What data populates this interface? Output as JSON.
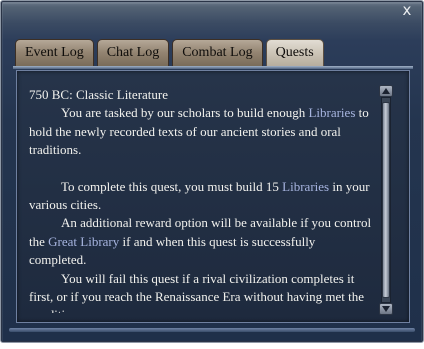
{
  "window": {
    "close_label": "x"
  },
  "tabs": [
    {
      "label": "Event Log",
      "active": false
    },
    {
      "label": "Chat Log",
      "active": false
    },
    {
      "label": "Combat Log",
      "active": false
    },
    {
      "label": "Quests",
      "active": true
    }
  ],
  "quest": {
    "heading": "750 BC: Classic Literature",
    "p1": {
      "before": "You are tasked by our scholars to build enough ",
      "link": "Libraries",
      "after": " to hold the newly recorded texts of our ancient stories and oral traditions."
    },
    "p2": {
      "before": "To complete this quest, you must build 15 ",
      "link": "Libraries",
      "after": " in your various cities."
    },
    "p3": {
      "before": "An additional reward option will be available if you control the ",
      "link": "Great Library",
      "after": " if and when this quest is successfully completed."
    },
    "p4": {
      "text": "You will fail this quest if a rival civilization completes it first, or if you reach the Renaissance Era without having met the conditions."
    }
  },
  "colors": {
    "link": "#a7b5e0",
    "text": "#f2f2ee"
  },
  "icons": {
    "close": "close-icon",
    "scroll_up": "arrow-up-icon",
    "scroll_down": "arrow-down-icon"
  }
}
